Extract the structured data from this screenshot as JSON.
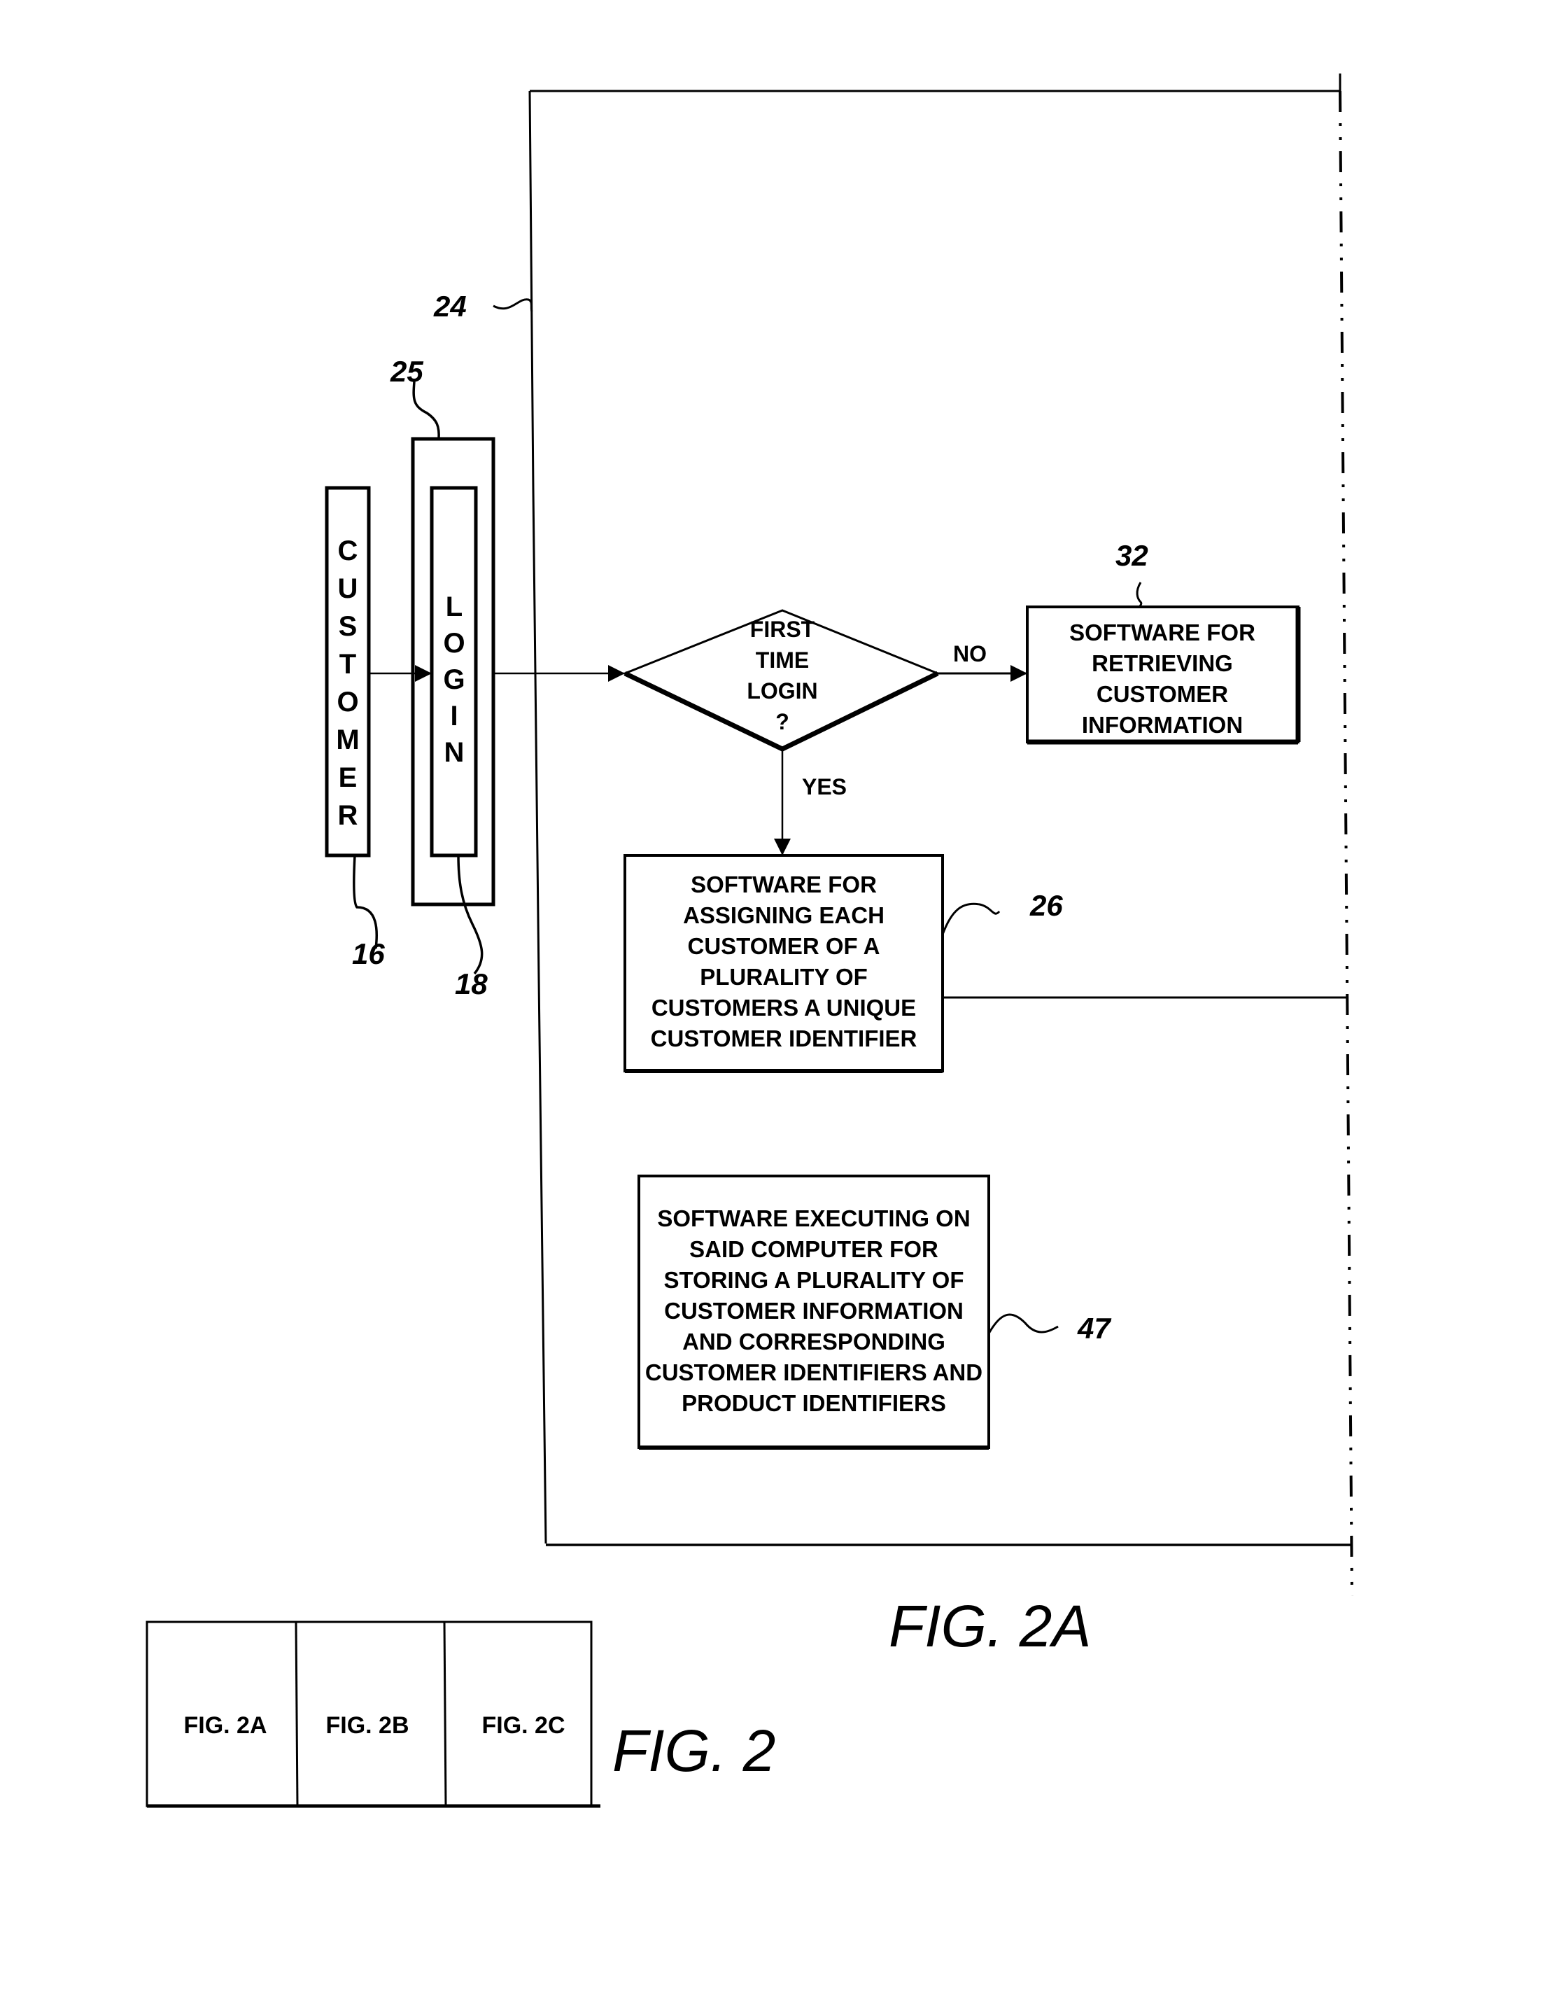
{
  "figure": {
    "title": "FIG. 2A",
    "system_ref": "24"
  },
  "customer": {
    "label": "CUSTOMER",
    "letters": [
      "C",
      "U",
      "S",
      "T",
      "O",
      "M",
      "E",
      "R"
    ],
    "ref": "16"
  },
  "login_group": {
    "ref": "25",
    "login": {
      "label": "LOGIN",
      "letters": [
        "L",
        "O",
        "G",
        "I",
        "N"
      ],
      "ref": "18"
    }
  },
  "decision": {
    "lines": [
      "FIRST",
      "TIME",
      "LOGIN",
      "?"
    ],
    "no_label": "NO",
    "yes_label": "YES"
  },
  "retrieve_box": {
    "ref": "32",
    "lines": [
      "SOFTWARE FOR",
      "RETRIEVING",
      "CUSTOMER",
      "INFORMATION"
    ]
  },
  "assign_box": {
    "ref": "26",
    "lines": [
      "SOFTWARE FOR",
      "ASSIGNING EACH",
      "CUSTOMER OF A",
      "PLURALITY OF",
      "CUSTOMERS A UNIQUE",
      "CUSTOMER IDENTIFIER"
    ]
  },
  "storing_box": {
    "ref": "47",
    "lines": [
      "SOFTWARE EXECUTING ON",
      "SAID COMPUTER FOR",
      "STORING A PLURALITY OF",
      "CUSTOMER INFORMATION",
      "AND CORRESPONDING",
      "CUSTOMER IDENTIFIERS AND",
      "PRODUCT IDENTIFIERS"
    ]
  },
  "sheet_map": {
    "title": "FIG. 2",
    "cells": [
      "FIG. 2A",
      "FIG. 2B",
      "FIG. 2C"
    ]
  }
}
